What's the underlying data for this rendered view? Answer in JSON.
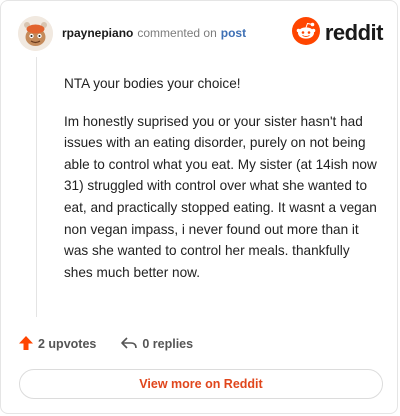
{
  "header": {
    "username": "rpaynepiano",
    "action_text": "commented on",
    "post_link": "post",
    "brand": "reddit"
  },
  "icons": {
    "avatar": "snoo-avatar",
    "brand_logo": "reddit-snoo-icon",
    "upvote": "upvote-arrow-icon",
    "reply": "reply-arrow-icon"
  },
  "colors": {
    "brand_orange": "#FF4500",
    "link_blue": "#3D6FB4",
    "view_more_text": "#E0461C"
  },
  "comment": {
    "paragraphs": [
      "NTA your bodies your choice!",
      "Im honestly suprised you or your sister hasn't had issues with an eating disorder, purely on not being able to control what you eat. My sister (at 14ish now 31) struggled with control over what she wanted to eat, and practically stopped eating. It wasnt a vegan non vegan impass, i never found out more than it was she wanted to control her meals. thankfully shes much better now."
    ]
  },
  "stats": {
    "upvotes": "2 upvotes",
    "replies": "0 replies"
  },
  "footer": {
    "view_more": "View more on Reddit"
  }
}
